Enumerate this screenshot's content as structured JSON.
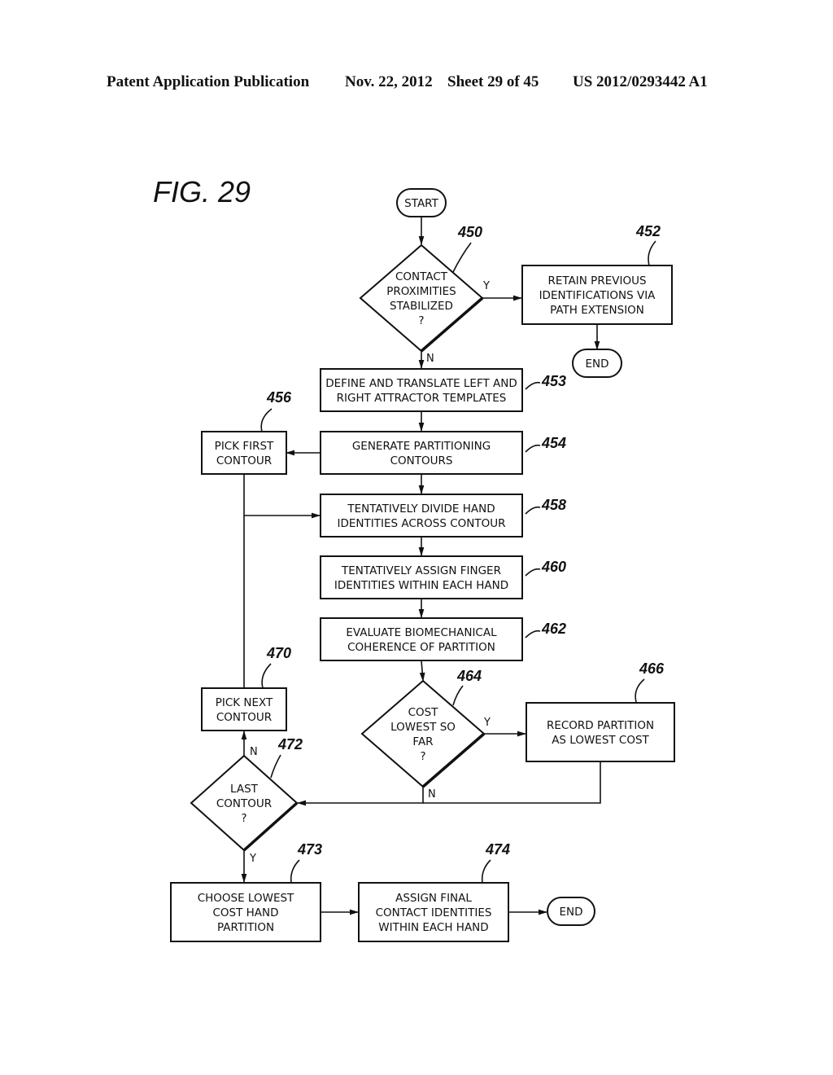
{
  "header": {
    "publication": "Patent Application Publication",
    "date": "Nov. 22, 2012",
    "sheet": "Sheet 29 of 45",
    "number": "US 2012/0293442 A1"
  },
  "figure": {
    "label": "FIG. 29"
  },
  "nodes": {
    "start": {
      "type": "terminal",
      "text": [
        "START"
      ]
    },
    "n450": {
      "type": "decision",
      "ref": "450",
      "text": [
        "CONTACT",
        "PROXIMITIES",
        "STABILIZED",
        "?"
      ]
    },
    "n452": {
      "type": "process",
      "ref": "452",
      "text": [
        "RETAIN PREVIOUS",
        "IDENTIFICATIONS VIA",
        "PATH EXTENSION"
      ]
    },
    "end1": {
      "type": "terminal",
      "text": [
        "END"
      ]
    },
    "n453": {
      "type": "process",
      "ref": "453",
      "text": [
        "DEFINE AND TRANSLATE LEFT AND",
        "RIGHT ATTRACTOR TEMPLATES"
      ]
    },
    "n454": {
      "type": "process",
      "ref": "454",
      "text": [
        "GENERATE PARTITIONING",
        "CONTOURS"
      ]
    },
    "n456": {
      "type": "process",
      "ref": "456",
      "text": [
        "PICK FIRST",
        "CONTOUR"
      ]
    },
    "n458": {
      "type": "process",
      "ref": "458",
      "text": [
        "TENTATIVELY DIVIDE HAND",
        "IDENTITIES ACROSS CONTOUR"
      ]
    },
    "n460": {
      "type": "process",
      "ref": "460",
      "text": [
        "TENTATIVELY ASSIGN FINGER",
        "IDENTITIES WITHIN EACH HAND"
      ]
    },
    "n462": {
      "type": "process",
      "ref": "462",
      "text": [
        "EVALUATE BIOMECHANICAL",
        "COHERENCE OF PARTITION"
      ]
    },
    "n464": {
      "type": "decision",
      "ref": "464",
      "text": [
        "COST",
        "LOWEST SO",
        "FAR",
        "?"
      ]
    },
    "n466": {
      "type": "process",
      "ref": "466",
      "text": [
        "RECORD PARTITION",
        "AS LOWEST COST"
      ]
    },
    "n470": {
      "type": "process",
      "ref": "470",
      "text": [
        "PICK NEXT",
        "CONTOUR"
      ]
    },
    "n472": {
      "type": "decision",
      "ref": "472",
      "text": [
        "LAST",
        "CONTOUR",
        "?"
      ]
    },
    "n473": {
      "type": "process",
      "ref": "473",
      "text": [
        "CHOOSE LOWEST",
        "COST HAND",
        "PARTITION"
      ]
    },
    "n474": {
      "type": "process",
      "ref": "474",
      "text": [
        "ASSIGN FINAL",
        "CONTACT IDENTITIES",
        "WITHIN EACH HAND"
      ]
    },
    "end2": {
      "type": "terminal",
      "text": [
        "END"
      ]
    }
  },
  "edges": [
    {
      "from": "start",
      "to": "n450",
      "label": ""
    },
    {
      "from": "n450",
      "to": "n452",
      "label": "Y"
    },
    {
      "from": "n452",
      "to": "end1",
      "label": ""
    },
    {
      "from": "n450",
      "to": "n453",
      "label": "N"
    },
    {
      "from": "n453",
      "to": "n454",
      "label": ""
    },
    {
      "from": "n454",
      "to": "n456",
      "label": ""
    },
    {
      "from": "n454",
      "to": "n458",
      "label": ""
    },
    {
      "from": "n456",
      "to": "n458",
      "label": ""
    },
    {
      "from": "n458",
      "to": "n460",
      "label": ""
    },
    {
      "from": "n460",
      "to": "n462",
      "label": ""
    },
    {
      "from": "n462",
      "to": "n464",
      "label": ""
    },
    {
      "from": "n464",
      "to": "n466",
      "label": "Y"
    },
    {
      "from": "n464",
      "to": "n472",
      "label": "N"
    },
    {
      "from": "n466",
      "to": "n472",
      "label": ""
    },
    {
      "from": "n472",
      "to": "n470",
      "label": "N"
    },
    {
      "from": "n470",
      "to": "n458",
      "label": ""
    },
    {
      "from": "n472",
      "to": "n473",
      "label": "Y"
    },
    {
      "from": "n473",
      "to": "n474",
      "label": ""
    },
    {
      "from": "n474",
      "to": "end2",
      "label": ""
    }
  ]
}
